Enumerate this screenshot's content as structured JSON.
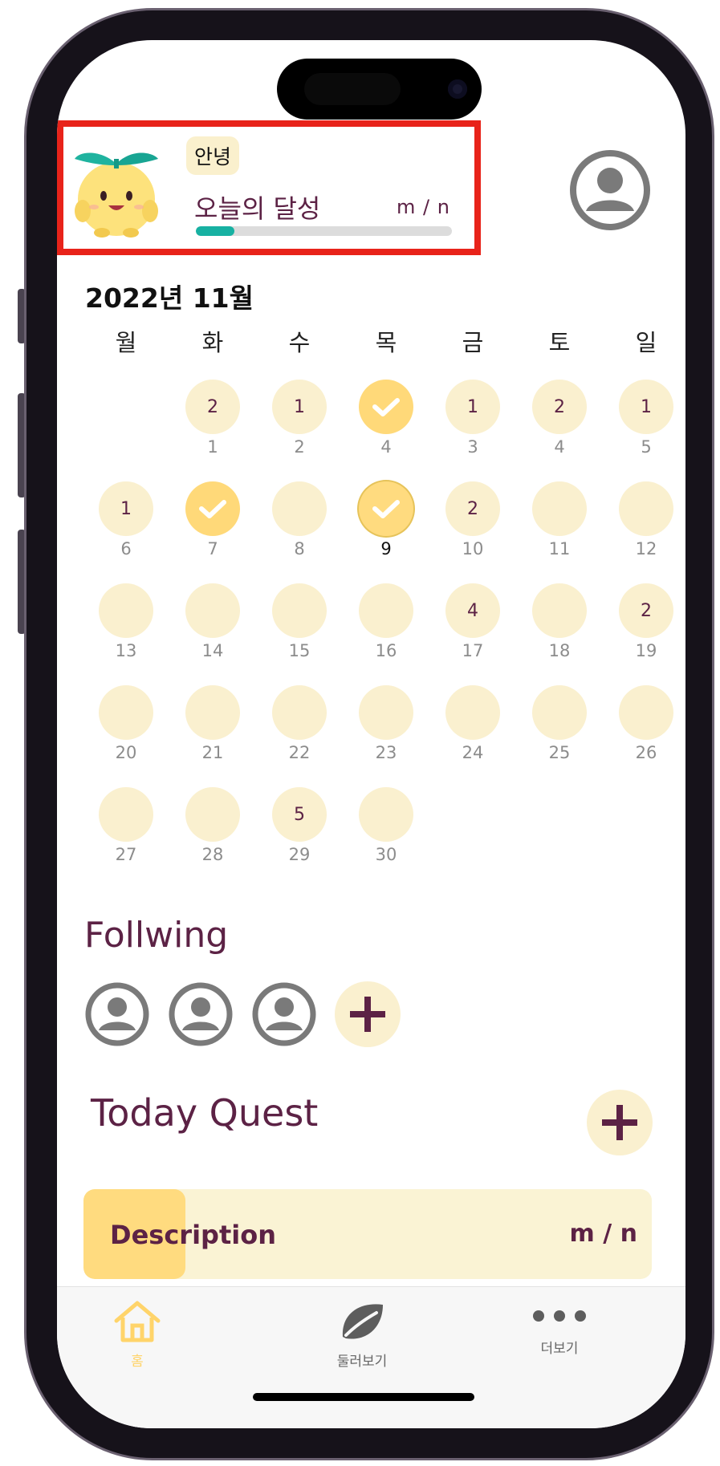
{
  "header": {
    "greeting": "안녕",
    "achievement_label": "오늘의 달성",
    "achievement_value": "m / n",
    "progress_fraction": 0.15
  },
  "calendar": {
    "month_label": "2022년 11월",
    "weekdays": [
      "월",
      "화",
      "수",
      "목",
      "금",
      "토",
      "일"
    ],
    "weeks": [
      [
        null,
        {
          "day": "1",
          "count": "2",
          "state": "count"
        },
        {
          "day": "2",
          "count": "1",
          "state": "count"
        },
        {
          "day": "4",
          "count": "",
          "state": "done"
        },
        {
          "day": "3",
          "count": "1",
          "state": "count"
        },
        {
          "day": "4",
          "count": "2",
          "state": "count"
        },
        {
          "day": "5",
          "count": "1",
          "state": "count"
        }
      ],
      [
        {
          "day": "6",
          "count": "1",
          "state": "count"
        },
        {
          "day": "7",
          "count": "",
          "state": "done"
        },
        {
          "day": "8",
          "count": "",
          "state": "empty"
        },
        {
          "day": "9",
          "count": "",
          "state": "today"
        },
        {
          "day": "10",
          "count": "2",
          "state": "count"
        },
        {
          "day": "11",
          "count": "",
          "state": "empty"
        },
        {
          "day": "12",
          "count": "",
          "state": "empty"
        }
      ],
      [
        {
          "day": "13",
          "count": "",
          "state": "empty"
        },
        {
          "day": "14",
          "count": "",
          "state": "empty"
        },
        {
          "day": "15",
          "count": "",
          "state": "empty"
        },
        {
          "day": "16",
          "count": "",
          "state": "empty"
        },
        {
          "day": "17",
          "count": "4",
          "state": "count"
        },
        {
          "day": "18",
          "count": "",
          "state": "empty"
        },
        {
          "day": "19",
          "count": "2",
          "state": "count"
        }
      ],
      [
        {
          "day": "20",
          "count": "",
          "state": "empty"
        },
        {
          "day": "21",
          "count": "",
          "state": "empty"
        },
        {
          "day": "22",
          "count": "",
          "state": "empty"
        },
        {
          "day": "23",
          "count": "",
          "state": "empty"
        },
        {
          "day": "24",
          "count": "",
          "state": "empty"
        },
        {
          "day": "25",
          "count": "",
          "state": "empty"
        },
        {
          "day": "26",
          "count": "",
          "state": "empty"
        }
      ],
      [
        {
          "day": "27",
          "count": "",
          "state": "empty"
        },
        {
          "day": "28",
          "count": "",
          "state": "empty"
        },
        {
          "day": "29",
          "count": "5",
          "state": "count"
        },
        {
          "day": "30",
          "count": "",
          "state": "empty"
        },
        null,
        null,
        null
      ]
    ]
  },
  "following": {
    "title": "Follwing",
    "avatars": [
      "user-avatar-icon",
      "user-avatar-icon",
      "user-avatar-icon"
    ],
    "add_icon": "plus-icon"
  },
  "quest": {
    "title": "Today Quest",
    "card": {
      "description": "Description",
      "value": "m / n",
      "progress_fraction": 0.18
    }
  },
  "tabbar": {
    "tabs": [
      {
        "label": "홈",
        "icon": "home-icon",
        "active": true
      },
      {
        "label": "둘러보기",
        "icon": "leaf-icon",
        "active": false
      },
      {
        "label": "더보기",
        "icon": "more-dots-icon",
        "active": false
      }
    ]
  },
  "colors": {
    "accent": "#5c2245",
    "bubble": "#faf0cf",
    "done": "#ffd979",
    "progress": "#17b1a2",
    "highlight_border": "#e8231a",
    "tab_active": "#ffd46a"
  }
}
